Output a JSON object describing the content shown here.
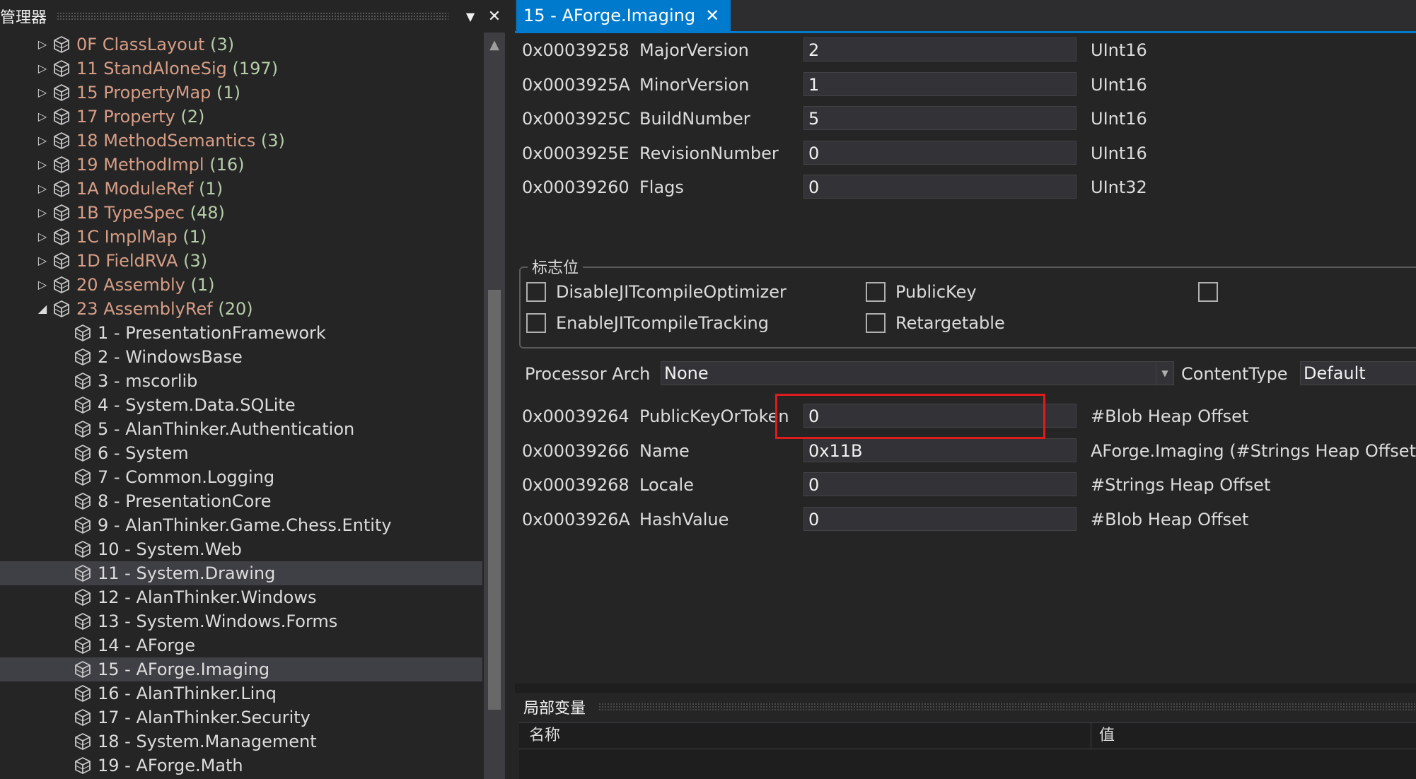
{
  "left_panel": {
    "title": "管理器",
    "dropdown_glyph": "▼",
    "close_glyph": "✕",
    "scroll_up_glyph": "▲",
    "tables": [
      {
        "id": "0F",
        "name": "ClassLayout",
        "count": "(3)"
      },
      {
        "id": "11",
        "name": "StandAloneSig",
        "count": "(197)"
      },
      {
        "id": "15",
        "name": "PropertyMap",
        "count": "(1)"
      },
      {
        "id": "17",
        "name": "Property",
        "count": "(2)"
      },
      {
        "id": "18",
        "name": "MethodSemantics",
        "count": "(3)"
      },
      {
        "id": "19",
        "name": "MethodImpl",
        "count": "(16)"
      },
      {
        "id": "1A",
        "name": "ModuleRef",
        "count": "(1)"
      },
      {
        "id": "1B",
        "name": "TypeSpec",
        "count": "(48)"
      },
      {
        "id": "1C",
        "name": "ImplMap",
        "count": "(1)"
      },
      {
        "id": "1D",
        "name": "FieldRVA",
        "count": "(3)"
      },
      {
        "id": "20",
        "name": "Assembly",
        "count": "(1)"
      },
      {
        "id": "23",
        "name": "AssemblyRef",
        "count": "(20)"
      }
    ],
    "assembly_refs": [
      "1 - PresentationFramework",
      "2 - WindowsBase",
      "3 - mscorlib",
      "4 - System.Data.SQLite",
      "5 - AlanThinker.Authentication",
      "6 - System",
      "7 - Common.Logging",
      "8 - PresentationCore",
      "9 - AlanThinker.Game.Chess.Entity",
      "10 - System.Web",
      "11 - System.Drawing",
      "12 - AlanThinker.Windows",
      "13 - System.Windows.Forms",
      "14 - AForge",
      "15 - AForge.Imaging",
      "16 - AlanThinker.Linq",
      "17 - AlanThinker.Security",
      "18 - System.Management",
      "19 - AForge.Math"
    ],
    "icon": "cube-icon",
    "colors": {
      "table_name": "#d69d85",
      "count": "#b5cea8",
      "selected_bg": "#3f3f46"
    }
  },
  "document": {
    "tab_title": "15 - AForge.Imaging",
    "tab_close_glyph": "✕",
    "accent": "#007acc",
    "fields_top": [
      {
        "offset": "0x00039258",
        "name": "MajorVersion",
        "value": "2",
        "type": "UInt16"
      },
      {
        "offset": "0x0003925A",
        "name": "MinorVersion",
        "value": "1",
        "type": "UInt16"
      },
      {
        "offset": "0x0003925C",
        "name": "BuildNumber",
        "value": "5",
        "type": "UInt16"
      },
      {
        "offset": "0x0003925E",
        "name": "RevisionNumber",
        "value": "0",
        "type": "UInt16"
      },
      {
        "offset": "0x00039260",
        "name": "Flags",
        "value": "0",
        "type": "UInt32"
      }
    ],
    "flags_group": {
      "legend": "标志位",
      "checkboxes": [
        {
          "label": "DisableJITcompileOptimizer",
          "checked": false
        },
        {
          "label": "PublicKey",
          "checked": false
        },
        {
          "label": "EnableJITcompileTracking",
          "checked": false
        },
        {
          "label": "Retargetable",
          "checked": false
        }
      ]
    },
    "processor_arch": {
      "label": "Processor Arch",
      "value": "None"
    },
    "content_type": {
      "label": "ContentType",
      "value": "Default"
    },
    "fields_bottom": [
      {
        "offset": "0x00039264",
        "name": "PublicKeyOrToken",
        "value": "0",
        "type": "#Blob Heap Offset"
      },
      {
        "offset": "0x00039266",
        "name": "Name",
        "value": "0x11B",
        "type": "AForge.Imaging (#Strings Heap Offset)"
      },
      {
        "offset": "0x00039268",
        "name": "Locale",
        "value": "0",
        "type": "#Strings Heap Offset"
      },
      {
        "offset": "0x0003926A",
        "name": "HashValue",
        "value": "0",
        "type": "#Blob Heap Offset"
      }
    ],
    "highlight_color": "#e01b1b"
  },
  "locals": {
    "title": "局部变量",
    "col_name": "名称",
    "col_value": "值"
  }
}
